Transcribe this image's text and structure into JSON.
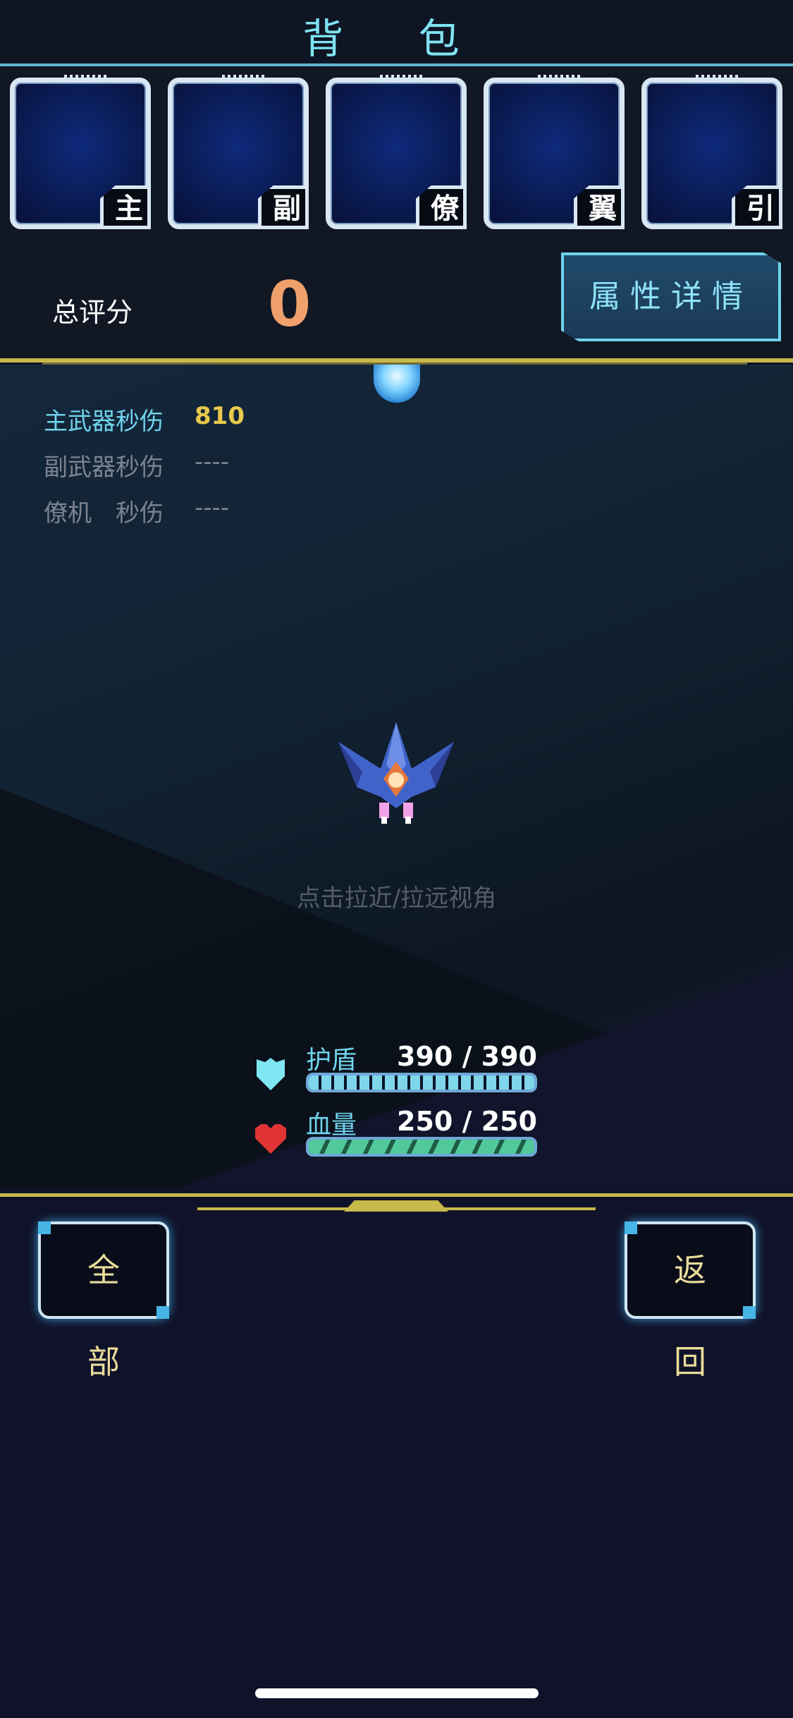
{
  "header": {
    "title": "背 包"
  },
  "slots": [
    {
      "tag": "主"
    },
    {
      "tag": "副"
    },
    {
      "tag": "僚"
    },
    {
      "tag": "翼"
    },
    {
      "tag": "引"
    }
  ],
  "score": {
    "label": "总评分",
    "value": "0"
  },
  "detail_button": {
    "label": "属性详情"
  },
  "stats": [
    {
      "label": "主武器秒伤",
      "value": "810"
    },
    {
      "label": "副武器秒伤",
      "value": "----"
    },
    {
      "label": "僚机　秒伤",
      "value": "----"
    }
  ],
  "hint": "点击拉近/拉远视角",
  "shield": {
    "label": "护盾",
    "value": "390 / 390",
    "fraction": 1.0,
    "icon": "shield-icon"
  },
  "hp": {
    "label": "血量",
    "value": "250 / 250",
    "fraction": 1.0,
    "icon": "heart-icon"
  },
  "buttons": {
    "all": "全部",
    "back": "返回"
  },
  "colors": {
    "accent": "#6fd3ec",
    "score": "#f0a06a",
    "dps": "#e8c94c",
    "gold_trim": "#c7b94a"
  }
}
